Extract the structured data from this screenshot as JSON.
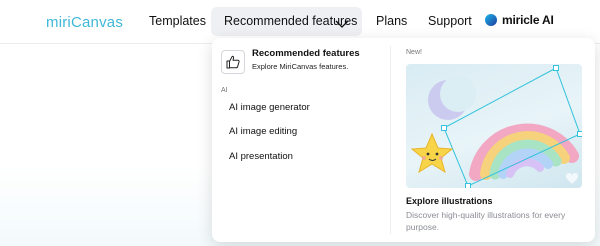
{
  "nav": {
    "logo_text": "miriCanvas",
    "templates": "Templates",
    "recommended": "Recommended features",
    "plans": "Plans",
    "support": "Support",
    "miricle": "miricle AI"
  },
  "dropdown": {
    "feature_title": "Recommended features",
    "feature_subtitle": "Explore MiriCanvas features.",
    "section_label": "AI",
    "items": [
      "AI image generator",
      "AI image editing",
      "AI presentation"
    ],
    "new_label": "New!",
    "illustration_title": "Explore illustrations",
    "illustration_desc": "Discover high-quality illustrations for every purpose."
  },
  "icons": {
    "chevron": "chevron-down-icon",
    "thumbs_up": "thumbs-up-icon",
    "miricle_badge": "miricle-badge-icon"
  },
  "colors": {
    "logo": "#3fb8d8",
    "nav_active_bg": "#eff0f3",
    "muted_text": "#8a8d94"
  }
}
